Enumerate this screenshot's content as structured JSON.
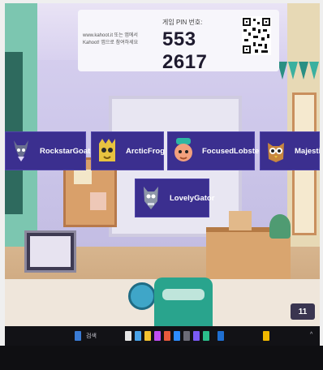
{
  "join": {
    "line1": "www.kahoot.it 또는 앱에서",
    "line2": "Kahoot! 앱으로 참여하세요",
    "pin_label": "게임 PIN 번호:",
    "pin": "553 2617"
  },
  "players": [
    {
      "name": "RockstarGoat",
      "avatar": "goat-avatar-icon"
    },
    {
      "name": "ArcticFrog",
      "avatar": "frog-avatar-icon"
    },
    {
      "name": "FocusedLobster",
      "avatar": "lobster-avatar-icon"
    },
    {
      "name": "MajesticCh",
      "avatar": "owl-avatar-icon"
    },
    {
      "name": "LovelyGator",
      "avatar": "gator-avatar-icon"
    }
  ],
  "status": {
    "player_count": "11"
  },
  "taskbar": {
    "search_text": "검색"
  },
  "colors": {
    "tag_bg": "#3b2f8f",
    "pin_text": "#1e1a2e"
  }
}
